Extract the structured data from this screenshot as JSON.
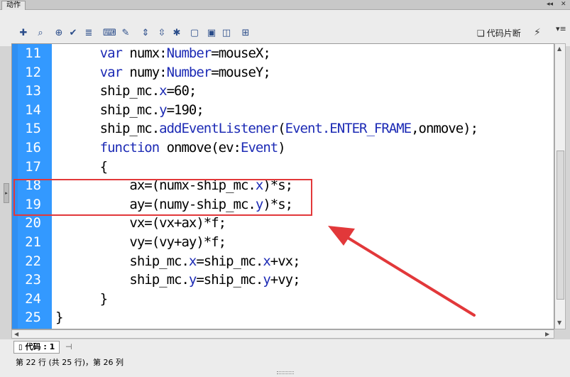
{
  "panel": {
    "tab_label": "动作",
    "minimize": "◂◂",
    "close": "✕",
    "menu": "▾≡"
  },
  "toolbar": {
    "icons": [
      "add-item-icon",
      "find-icon",
      "target-icon",
      "check-syntax-icon",
      "auto-format-icon",
      "code-hint-icon",
      "debug-options-icon",
      "collapse-braces-icon",
      "collapse-selection-icon",
      "expand-all-icon",
      "apply-block-comment-icon",
      "apply-line-comment-icon",
      "remove-comment-icon",
      "show-hide-toolbox-icon"
    ],
    "snippets_label": "代码片断",
    "wand_icon": "wand-icon"
  },
  "editor": {
    "lines": [
      {
        "num": "11",
        "parts": [
          [
            "      ",
            ""
          ],
          [
            "var",
            "kw"
          ],
          [
            " numx:",
            ""
          ],
          [
            "Number",
            "ty"
          ],
          [
            "=mouseX;",
            ""
          ]
        ]
      },
      {
        "num": "12",
        "parts": [
          [
            "      ",
            ""
          ],
          [
            "var",
            "kw"
          ],
          [
            " numy:",
            ""
          ],
          [
            "Number",
            "ty"
          ],
          [
            "=mouseY;",
            ""
          ]
        ]
      },
      {
        "num": "13",
        "parts": [
          [
            "      ship_mc.",
            ""
          ],
          [
            "x",
            "ty"
          ],
          [
            "=60;",
            ""
          ]
        ]
      },
      {
        "num": "14",
        "parts": [
          [
            "      ship_mc.",
            ""
          ],
          [
            "y",
            "ty"
          ],
          [
            "=190;",
            ""
          ]
        ]
      },
      {
        "num": "15",
        "parts": [
          [
            "      ship_mc.",
            ""
          ],
          [
            "addEventListener",
            "kw"
          ],
          [
            "(",
            ""
          ],
          [
            "Event.ENTER_FRAME",
            "ty"
          ],
          [
            ",onmove);",
            ""
          ]
        ]
      },
      {
        "num": "16",
        "parts": [
          [
            "      ",
            ""
          ],
          [
            "function",
            "kw"
          ],
          [
            " onmove(ev:",
            ""
          ],
          [
            "Event",
            "ty"
          ],
          [
            ")",
            ""
          ]
        ]
      },
      {
        "num": "17",
        "parts": [
          [
            "      {",
            ""
          ]
        ]
      },
      {
        "num": "18",
        "parts": [
          [
            "          ax=(numx-ship_mc.",
            ""
          ],
          [
            "x",
            "ty"
          ],
          [
            ")*s;",
            ""
          ]
        ]
      },
      {
        "num": "19",
        "parts": [
          [
            "          ay=(numy-ship_mc.",
            ""
          ],
          [
            "y",
            "ty"
          ],
          [
            ")*s;",
            ""
          ]
        ]
      },
      {
        "num": "20",
        "parts": [
          [
            "          vx=(vx+ax)*f;",
            ""
          ]
        ]
      },
      {
        "num": "21",
        "parts": [
          [
            "          vy=(vy+ay)*f;",
            ""
          ]
        ]
      },
      {
        "num": "22",
        "parts": [
          [
            "          ship_mc.",
            ""
          ],
          [
            "x",
            "ty"
          ],
          [
            "=ship_mc.",
            ""
          ],
          [
            "x",
            "ty"
          ],
          [
            "+vx;",
            ""
          ]
        ]
      },
      {
        "num": "23",
        "parts": [
          [
            "          ship_mc.",
            ""
          ],
          [
            "y",
            "ty"
          ],
          [
            "=ship_mc.",
            ""
          ],
          [
            "y",
            "ty"
          ],
          [
            "+vy;",
            ""
          ]
        ]
      },
      {
        "num": "24",
        "parts": [
          [
            "      }",
            ""
          ]
        ]
      },
      {
        "num": "25",
        "parts": [
          [
            "}",
            ""
          ]
        ]
      }
    ]
  },
  "bottom": {
    "code_tab_label": "代码 : 1",
    "status_text": "第 22 行 (共 25 行)，第 26 列"
  },
  "annotation": {
    "highlight_color": "#e2383a",
    "highlighted_lines": [
      "18",
      "19"
    ]
  },
  "colors": {
    "gutter": "#3399ff",
    "keyword": "#1d2bb5"
  }
}
